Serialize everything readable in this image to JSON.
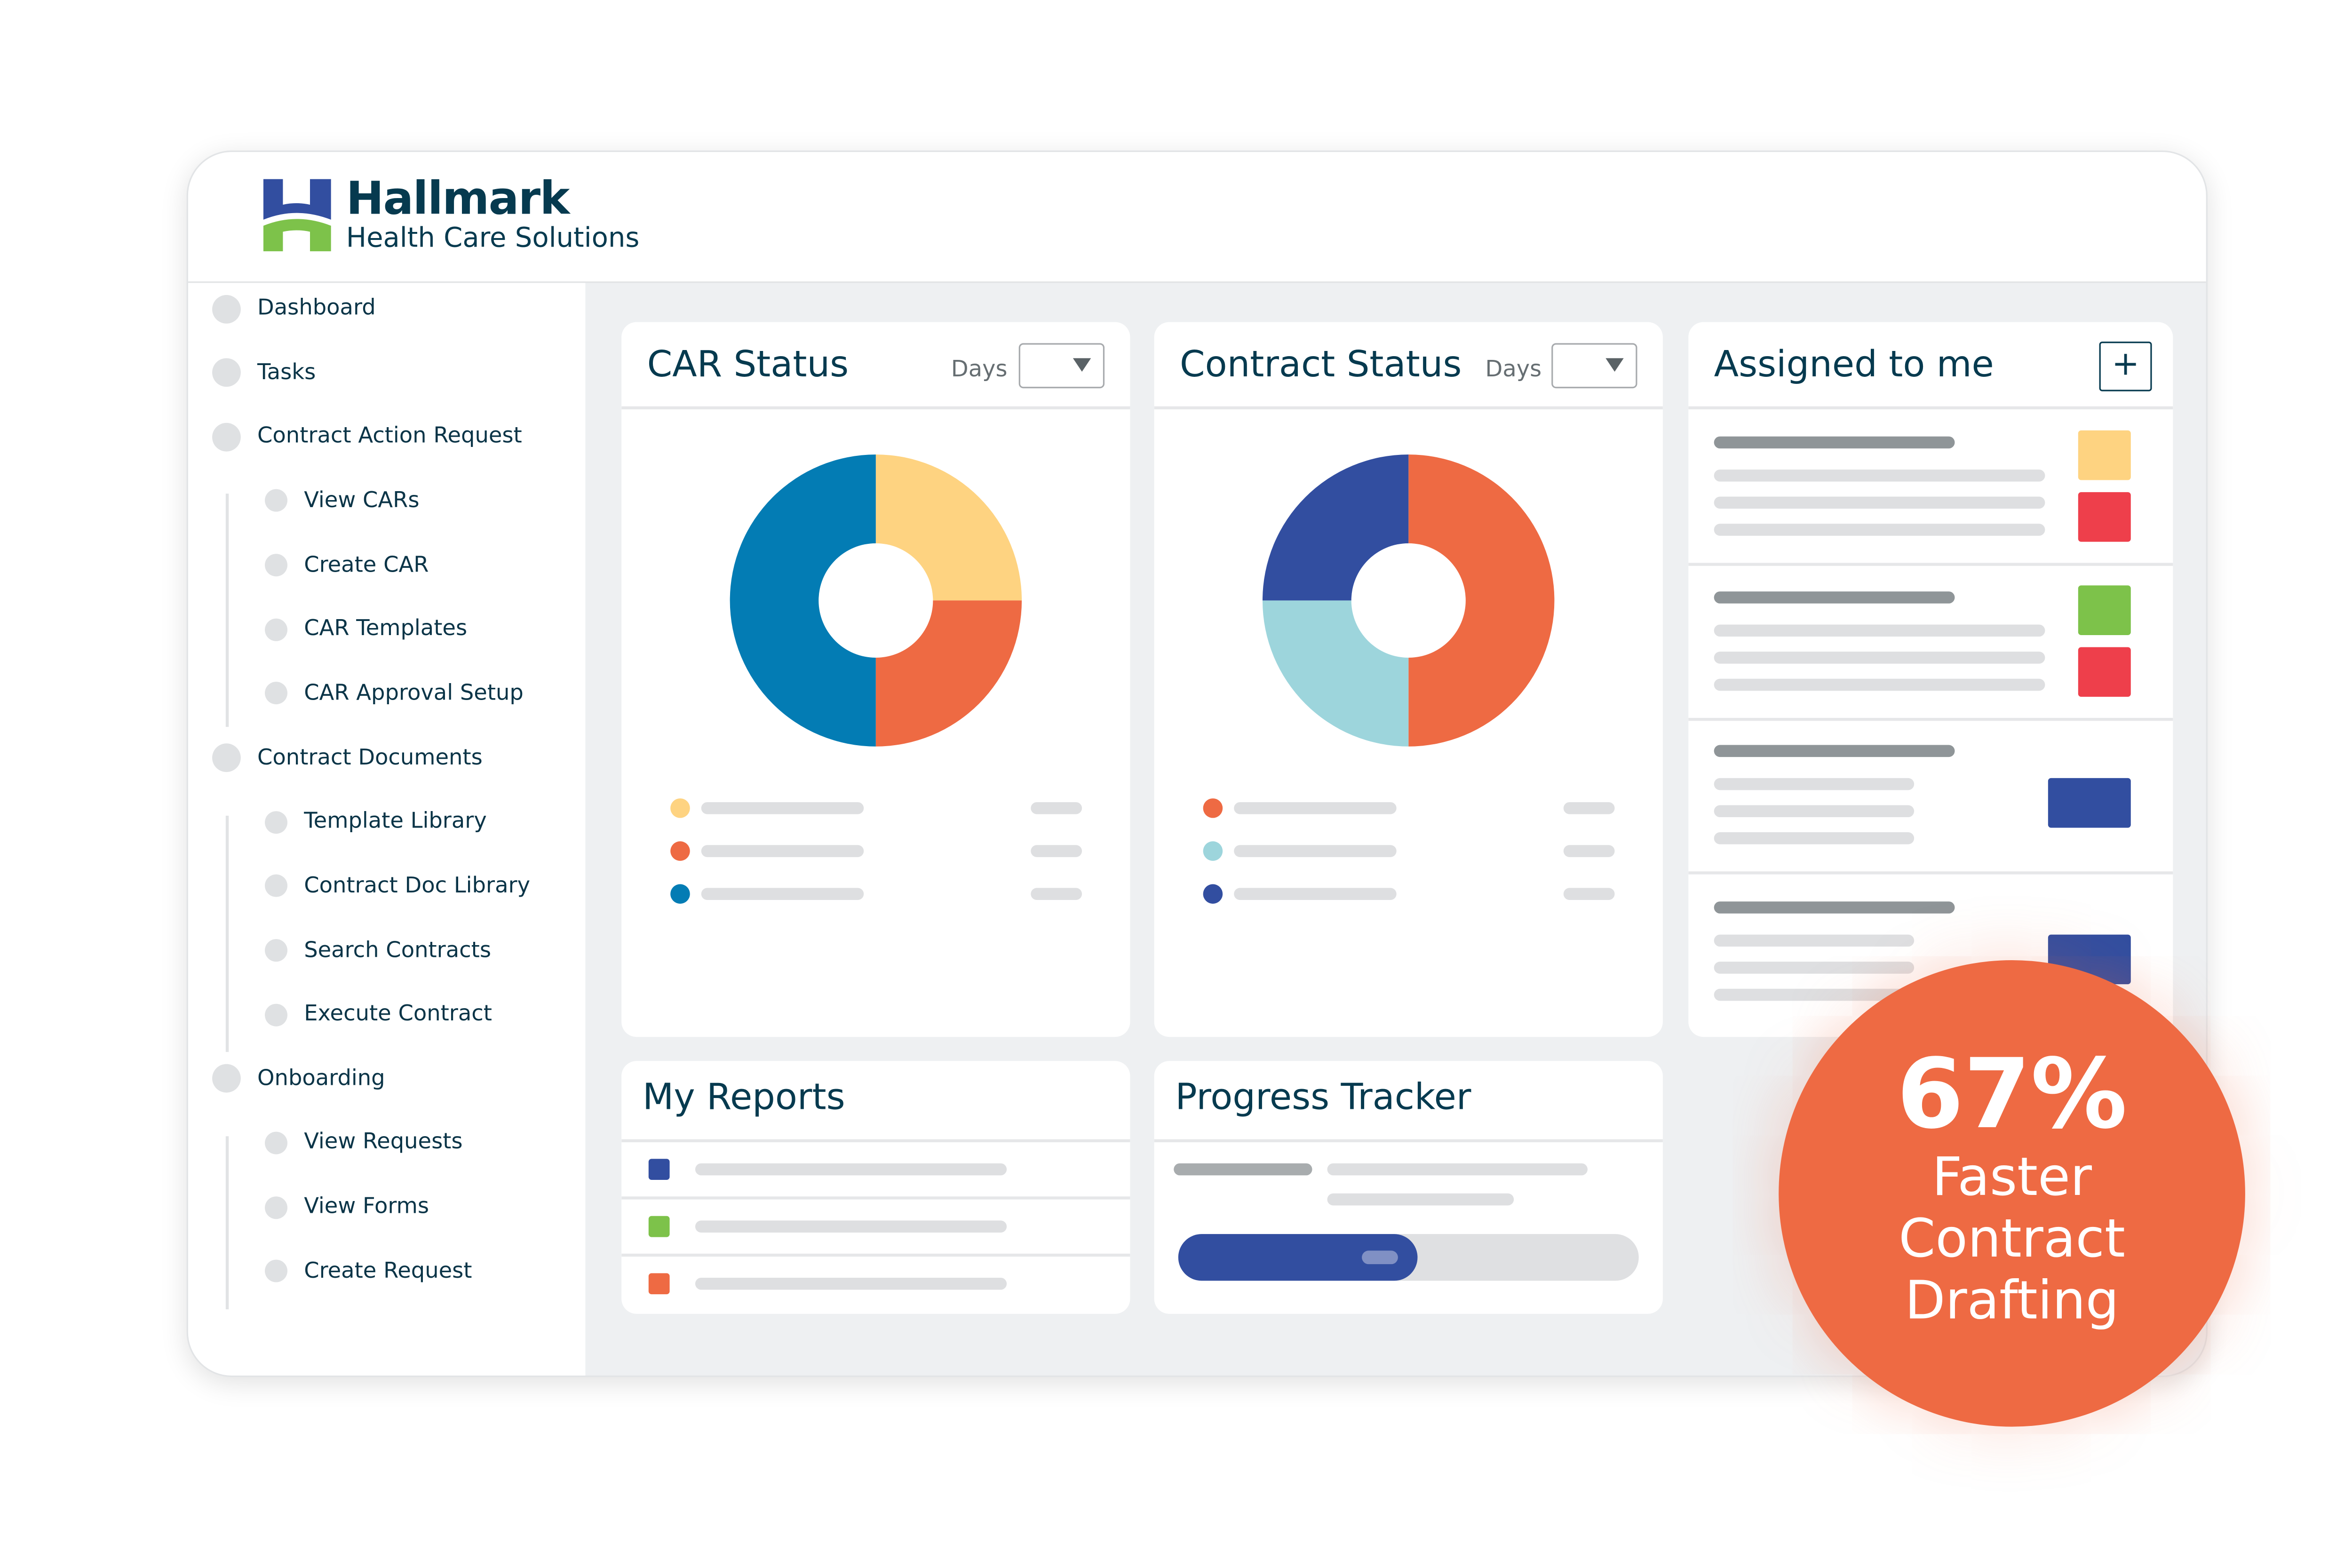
{
  "brand": {
    "name": "Hallmark",
    "tagline": "Health Care Solutions",
    "logo_colors": {
      "top": "#324ea0",
      "bottom": "#7dc24a"
    }
  },
  "sidebar": {
    "items": [
      {
        "label": "Dashboard",
        "level": 0
      },
      {
        "label": "Tasks",
        "level": 0
      },
      {
        "label": "Contract Action Request",
        "level": 0
      },
      {
        "label": "View CARs",
        "level": 1
      },
      {
        "label": "Create CAR",
        "level": 1
      },
      {
        "label": "CAR Templates",
        "level": 1
      },
      {
        "label": "CAR Approval Setup",
        "level": 1
      },
      {
        "label": "Contract Documents",
        "level": 0
      },
      {
        "label": "Template Library",
        "level": 1
      },
      {
        "label": "Contract Doc Library",
        "level": 1
      },
      {
        "label": "Search Contracts",
        "level": 1
      },
      {
        "label": "Execute Contract",
        "level": 1
      },
      {
        "label": "Onboarding",
        "level": 0
      },
      {
        "label": "View Requests",
        "level": 1
      },
      {
        "label": "View Forms",
        "level": 1
      },
      {
        "label": "Create Request",
        "level": 1
      }
    ]
  },
  "car_status": {
    "title": "CAR Status",
    "filter_label": "Days",
    "icon": "chevron-down-icon"
  },
  "contract_status": {
    "title": "Contract Status",
    "filter_label": "Days",
    "icon": "chevron-down-icon"
  },
  "assigned": {
    "title": "Assigned to me",
    "add_icon": "plus-icon",
    "rows": [
      {
        "tags": [
          "#fed381",
          "#ee3f4b"
        ]
      },
      {
        "tags": [
          "#7dc24a",
          "#ee3f4b"
        ]
      },
      {
        "tags": [
          "#324ea0"
        ]
      },
      {
        "tags": [
          "#324ea0"
        ]
      }
    ]
  },
  "my_reports": {
    "title": "My Reports",
    "rows": [
      {
        "color": "#324ea0"
      },
      {
        "color": "#7dc24a"
      },
      {
        "color": "#ee6a43"
      }
    ]
  },
  "progress_tracker": {
    "title": "Progress Tracker",
    "progress_percent": 52,
    "fill_color": "#324ea0"
  },
  "badge": {
    "value": "67%",
    "lines": [
      "Faster",
      "Contract",
      "Drafting"
    ],
    "color": "#ee6a43"
  },
  "chart_data": [
    {
      "type": "pie",
      "title": "CAR Status",
      "values": [
        25,
        25,
        50
      ],
      "colors": [
        "#fed381",
        "#ee6a43",
        "#037cb4"
      ],
      "donut": true
    },
    {
      "type": "pie",
      "title": "Contract Status",
      "values": [
        50,
        25,
        25
      ],
      "colors": [
        "#ee6a43",
        "#9dd5dc",
        "#324ea0"
      ],
      "donut": true
    }
  ]
}
